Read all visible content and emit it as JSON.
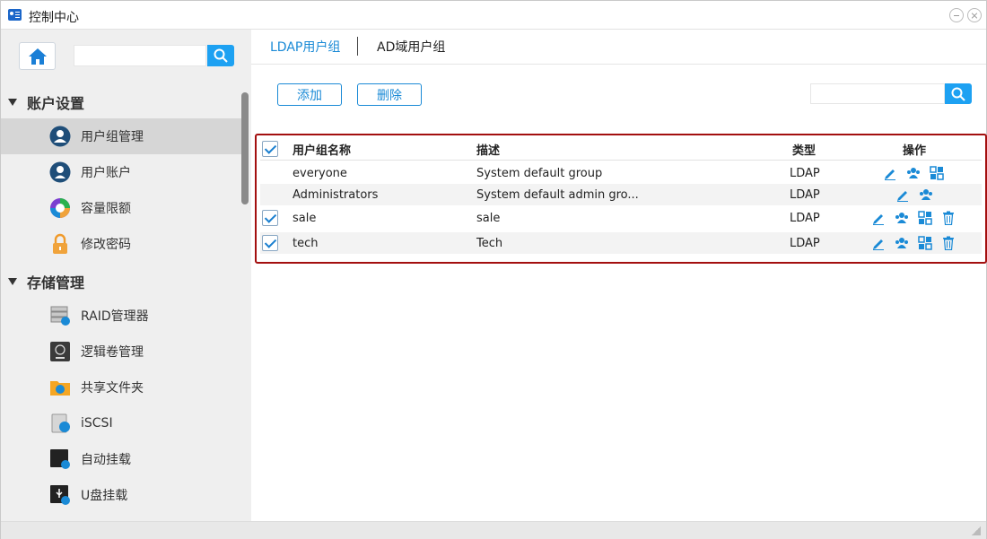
{
  "window": {
    "title": "控制中心"
  },
  "sidebar": {
    "search_placeholder": "",
    "sections": [
      {
        "title": "账户设置",
        "items": [
          {
            "label": "用户组管理",
            "icon": "user-group-icon",
            "active": true
          },
          {
            "label": "用户账户",
            "icon": "user-account-icon"
          },
          {
            "label": "容量限额",
            "icon": "quota-pie-icon"
          },
          {
            "label": "修改密码",
            "icon": "lock-icon"
          }
        ]
      },
      {
        "title": "存储管理",
        "items": [
          {
            "label": "RAID管理器",
            "icon": "raid-icon"
          },
          {
            "label": "逻辑卷管理",
            "icon": "lvm-icon"
          },
          {
            "label": "共享文件夹",
            "icon": "shared-folder-icon"
          },
          {
            "label": "iSCSI",
            "icon": "iscsi-icon"
          },
          {
            "label": "自动挂载",
            "icon": "auto-mount-icon"
          },
          {
            "label": "U盘挂载",
            "icon": "usb-mount-icon"
          }
        ]
      }
    ]
  },
  "main": {
    "tabs": [
      {
        "label": "LDAP用户组",
        "active": true
      },
      {
        "label": "AD域用户组",
        "active": false
      }
    ],
    "toolbar": {
      "add_label": "添加",
      "delete_label": "删除",
      "search_placeholder": ""
    },
    "table": {
      "columns": [
        "用户组名称",
        "描述",
        "类型",
        "操作"
      ],
      "rows": [
        {
          "name": "everyone",
          "desc": "System default group",
          "type": "LDAP",
          "checkbox": false,
          "checked": false,
          "ops": [
            "edit-icon",
            "members-icon",
            "permissions-icon"
          ]
        },
        {
          "name": "Administrators",
          "desc": "System default admin gro...",
          "type": "LDAP",
          "checkbox": false,
          "checked": false,
          "ops": [
            "edit-icon",
            "members-icon"
          ]
        },
        {
          "name": "sale",
          "desc": "sale",
          "type": "LDAP",
          "checkbox": true,
          "checked": true,
          "ops": [
            "edit-icon",
            "members-icon",
            "permissions-icon",
            "delete-icon"
          ]
        },
        {
          "name": "tech",
          "desc": "Tech",
          "type": "LDAP",
          "checkbox": true,
          "checked": true,
          "ops": [
            "edit-icon",
            "members-icon",
            "permissions-icon",
            "delete-icon"
          ]
        }
      ]
    }
  },
  "colors": {
    "accent": "#1a8ad6",
    "search_button": "#1da1f2",
    "selection_border": "#a30f0f"
  }
}
